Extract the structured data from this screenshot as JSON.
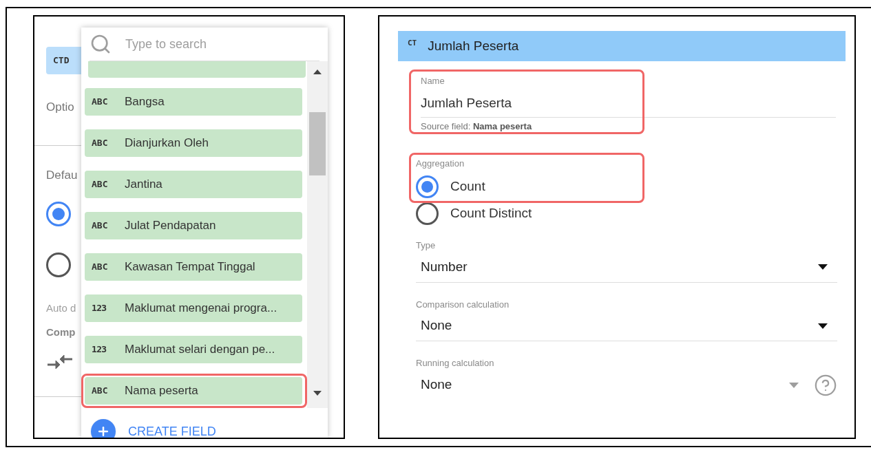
{
  "left_panel": {
    "chip": "CTD",
    "options_label": "Optio",
    "default_label": "Defau",
    "default_options": [
      {
        "selected": true
      },
      {
        "selected": false
      }
    ],
    "auto_label": "Auto d",
    "compare_label": "Comp"
  },
  "field_picker": {
    "search": {
      "placeholder": "Type to search"
    },
    "fields": [
      {
        "kind": "text",
        "type_label": "ABC",
        "name": "Bangsa",
        "highlighted": false
      },
      {
        "kind": "text",
        "type_label": "ABC",
        "name": "Dianjurkan Oleh",
        "highlighted": false
      },
      {
        "kind": "text",
        "type_label": "ABC",
        "name": "Jantina",
        "highlighted": false
      },
      {
        "kind": "text",
        "type_label": "ABC",
        "name": "Julat Pendapatan",
        "highlighted": false
      },
      {
        "kind": "text",
        "type_label": "ABC",
        "name": "Kawasan Tempat Tinggal",
        "highlighted": false
      },
      {
        "kind": "number",
        "type_label": "123",
        "name": "Maklumat mengenai progra...",
        "highlighted": false
      },
      {
        "kind": "number",
        "type_label": "123",
        "name": "Maklumat selari dengan pe...",
        "highlighted": false
      },
      {
        "kind": "text",
        "type_label": "ABC",
        "name": "Nama peserta",
        "highlighted": true
      }
    ],
    "create_button": "CREATE FIELD"
  },
  "editor": {
    "header": {
      "badge": "CT",
      "title": "Jumlah Peserta"
    },
    "name_field": {
      "label": "Name",
      "value": "Jumlah Peserta",
      "helper": "Source field: **Nama peserta**",
      "highlighted": true
    },
    "aggregation": {
      "label": "Aggregation",
      "highlighted": true,
      "options": [
        {
          "label": "Count",
          "selected": true
        },
        {
          "label": "Count Distinct",
          "selected": false
        }
      ]
    },
    "selects": [
      {
        "label": "Type",
        "value": "Number",
        "help": false
      },
      {
        "label": "Comparison calculation",
        "value": "None",
        "help": false
      },
      {
        "label": "Running calculation",
        "value": "None",
        "help": true
      }
    ]
  }
}
